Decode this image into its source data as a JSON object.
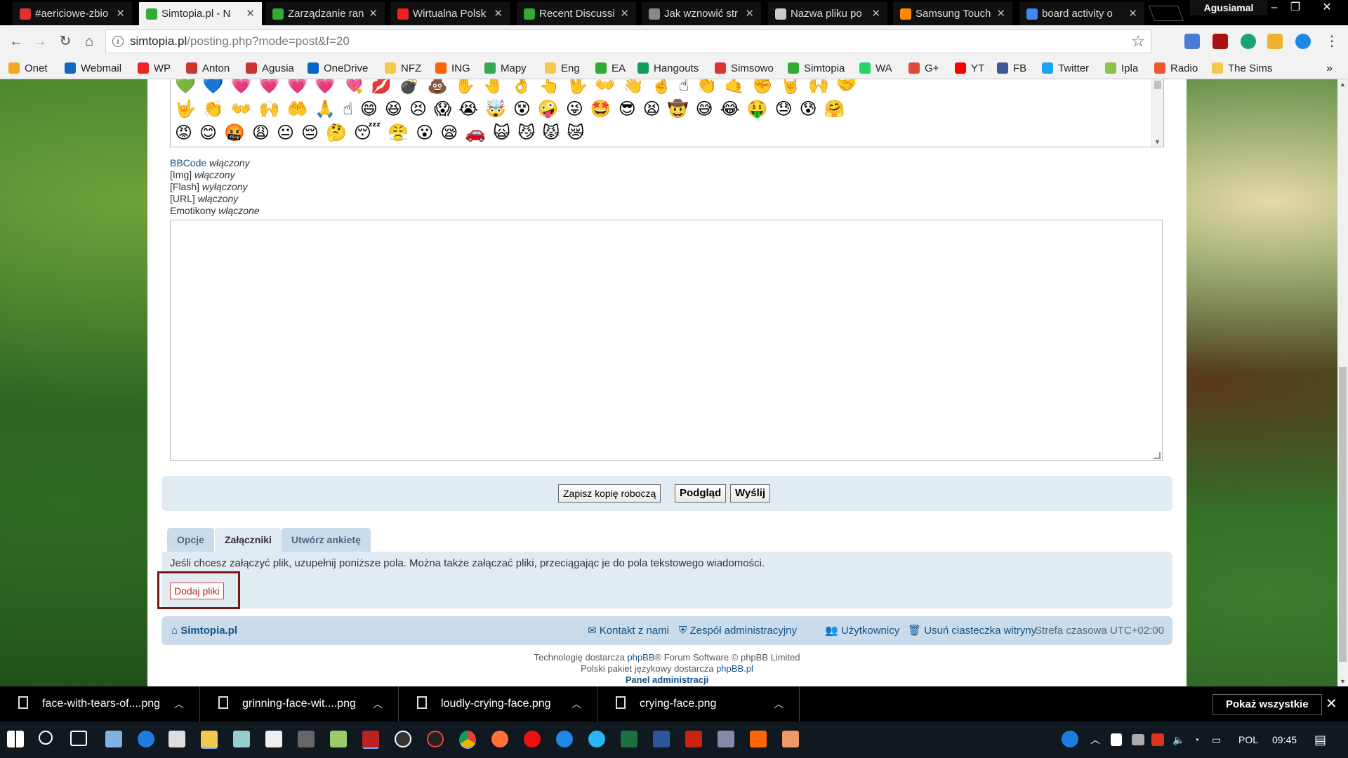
{
  "browser": {
    "tabs": [
      {
        "title": "#aericiowe-zbio",
        "color": "#d33"
      },
      {
        "title": "Simtopia.pl - N",
        "color": "#3a3"
      },
      {
        "title": "Zarządzanie ran",
        "color": "#3a3"
      },
      {
        "title": "Wirtualna Polsk",
        "color": "#e22"
      },
      {
        "title": "Recent Discussi",
        "color": "#3a3"
      },
      {
        "title": "Jak wznowić str",
        "color": "#888"
      },
      {
        "title": "Nazwa pliku po",
        "color": "#ccc"
      },
      {
        "title": "Samsung Touch",
        "color": "#f80"
      },
      {
        "title": "board activity o",
        "color": "#4285f4"
      }
    ],
    "profile_name": "Agusiamal",
    "url_host": "simtopia.pl",
    "url_path": "/posting.php?mode=post&f=20",
    "bookmarks": [
      {
        "label": "Onet",
        "color": "#f5a623"
      },
      {
        "label": "Webmail",
        "color": "#1565c0"
      },
      {
        "label": "WP",
        "color": "#e22"
      },
      {
        "label": "Anton",
        "color": "#c33"
      },
      {
        "label": "Agusia",
        "color": "#c33"
      },
      {
        "label": "OneDrive",
        "color": "#0a64c8"
      },
      {
        "label": "NFZ",
        "color": "#f3c84b"
      },
      {
        "label": "ING",
        "color": "#ff6200"
      },
      {
        "label": "Mapy",
        "color": "#34a853"
      },
      {
        "label": "Eng",
        "color": "#f3c84b"
      },
      {
        "label": "EA",
        "color": "#3a3"
      },
      {
        "label": "Hangouts",
        "color": "#0f9d58"
      },
      {
        "label": "Simsowo",
        "color": "#d33"
      },
      {
        "label": "Simtopia",
        "color": "#3a3"
      },
      {
        "label": "WA",
        "color": "#25d366"
      },
      {
        "label": "G+",
        "color": "#dd4b39"
      },
      {
        "label": "YT",
        "color": "#f00"
      },
      {
        "label": "FB",
        "color": "#3b5998"
      },
      {
        "label": "Twitter",
        "color": "#1da1f2"
      },
      {
        "label": "Ipla",
        "color": "#8bc34a"
      },
      {
        "label": "Radio",
        "color": "#e53"
      },
      {
        "label": "The Sims",
        "color": "#f3c84b"
      }
    ],
    "bookmarks_more": "»"
  },
  "page": {
    "smiley_rows": [
      "💚💙💗💗💗💗💘💋💣💩✋🤚👌👆🖖👐👋🤞☝👏🤙✊🤘🙌🤝",
      "🤟👏👐🙌🤲🙏☝😄😆😣😱😭🤯😵🤪😜🤩😎😫🤠😅😂🤑😓😰🤗",
      "😡😊🤬😩😐😔🤔😴😤😮😪🚗🙀😼😾😿"
    ],
    "status": {
      "bbcode_label": "BBCode",
      "bbcode_state": "włączony",
      "img_label": "[Img]",
      "img_state": "włączony",
      "flash_label": "[Flash]",
      "flash_state": "wyłączony",
      "url_label": "[URL]",
      "url_state": "włączony",
      "smilies_label": "Emotikony",
      "smilies_state": "włączone"
    },
    "message_text": "",
    "buttons": {
      "save_draft": "Zapisz kopię roboczą",
      "preview": "Podgląd",
      "submit": "Wyślij"
    },
    "tabs": {
      "options": "Opcje",
      "attachments": "Załączniki",
      "poll": "Utwórz ankietę"
    },
    "attach_message": "Jeśli chcesz załączyć plik, uzupełnij poniższe pola. Można także załączać pliki, przeciągając je do pola tekstowego wiadomości.",
    "add_files": "Dodaj pliki",
    "navbar": {
      "home": "Simtopia.pl",
      "contact": "Kontakt z nami",
      "team": "Zespół administracyjny",
      "members": "Użytkownicy",
      "delete_cookies": "Usuń ciasteczka witryny",
      "timezone": "Strefa czasowa UTC+02:00"
    },
    "footer": {
      "powered_pre": "Technologię dostarcza",
      "phpbb": "phpBB",
      "powered_post": "® Forum Software © phpBB Limited",
      "lang_pre": "Polski pakiet językowy dostarcza",
      "phpbb_pl": "phpBB.pl",
      "admin_panel": "Panel administracji"
    }
  },
  "downloads": {
    "items": [
      "face-with-tears-of....png",
      "grinning-face-wit....png",
      "loudly-crying-face.png",
      "crying-face.png"
    ],
    "show_all": "Pokaż wszystkie",
    "close": "✕"
  },
  "taskbar": {
    "language": "POL",
    "time": "09:45"
  }
}
